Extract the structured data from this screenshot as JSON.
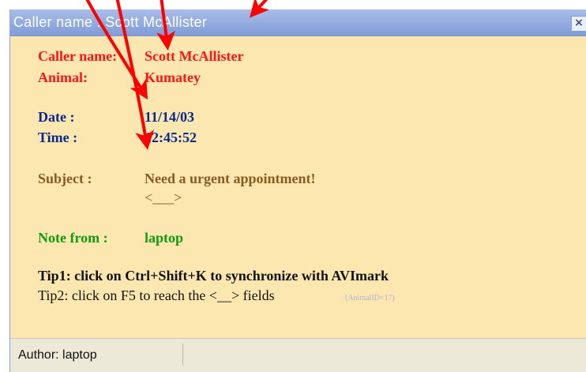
{
  "window": {
    "title": "Caller name : Scott McAllister",
    "close_icon": "close-icon"
  },
  "caller": {
    "caller_name_label": "Caller name:",
    "caller_name_value": "Scott McAllister",
    "animal_label": "Animal:",
    "animal_value": "Kumatey"
  },
  "datetime": {
    "date_label": "Date :",
    "date_value": "11/14/03",
    "time_label": "Time :",
    "time_value": "12:45:52"
  },
  "subject": {
    "label": "Subject :",
    "value": "Need a urgent appointment!",
    "placeholder": "<___>"
  },
  "note": {
    "label": "Note from :",
    "value": "laptop"
  },
  "tips": {
    "tip1": "Tip1: click on Ctrl+Shift+K to synchronize with AVImark",
    "tip2": "Tip2: click on F5 to reach the <__> fields",
    "animal_id": "(AnimalID=17)"
  },
  "status": {
    "author": "Author: laptop"
  },
  "colors": {
    "background": "#fde7b0",
    "titlebar": "#8ea3d8",
    "arrow": "#ff0000"
  }
}
